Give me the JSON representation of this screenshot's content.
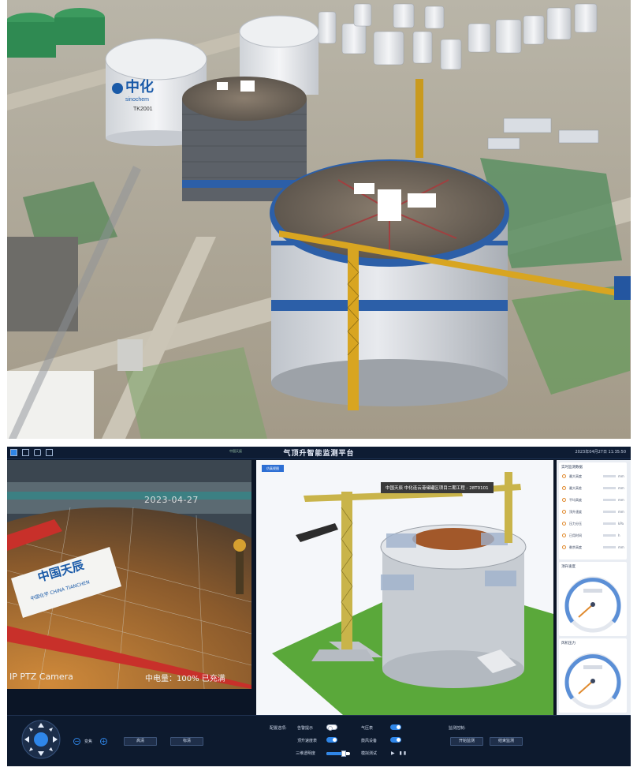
{
  "dashboard": {
    "title": "气顶升智能监测平台",
    "logo_text": "中国天辰",
    "datetime": "2023年04月27日 11:35:50",
    "toolbar_icons": [
      "layout-icon",
      "copy-icon",
      "cube-icon",
      "window-icon"
    ]
  },
  "camera": {
    "date_stamp": "2023-04-27",
    "label": "IP PTZ Camera",
    "status": "中电量：100% 已充满",
    "banner_cn": "中国天辰",
    "banner_sub": "中国化学 CHINA TIANCHEN"
  },
  "scene": {
    "badge": "仿真视图",
    "banner": "中国天辰 中化连云港储罐区项目二期工程 - 28T0101"
  },
  "side_panel": {
    "realtime_title": "实时监测数据",
    "metrics": [
      {
        "label": "最大高度",
        "unit": "mm"
      },
      {
        "label": "最大高差",
        "unit": "mm"
      },
      {
        "label": "平均高度",
        "unit": "mm"
      },
      {
        "label": "顶升速度",
        "unit": "mm"
      },
      {
        "label": "压力分压",
        "unit": "kPa"
      },
      {
        "label": "已用时间",
        "unit": "h"
      },
      {
        "label": "剩余高度",
        "unit": "mm"
      }
    ],
    "gauge1_title": "顶升速度",
    "gauge2_title": "风机压力"
  },
  "controls": {
    "zoom_label": "变焦",
    "btn_hd": "高清",
    "btn_sd": "标清",
    "config_label": "配置选项:",
    "opt_alarm": "告警提示",
    "opt_speed": "顶升速度表",
    "opt_transparency": "三维透明度",
    "opt_pressure": "气压表",
    "opt_fan": "鼓风设备",
    "opt_sim": "模拟测试",
    "monitor_label": "监测控制:",
    "btn_start": "开始监测",
    "btn_stop": "结束监测"
  },
  "colors": {
    "accent": "#2f86e8",
    "panel_bg": "#0b1526",
    "grass": "#5aa83a"
  }
}
